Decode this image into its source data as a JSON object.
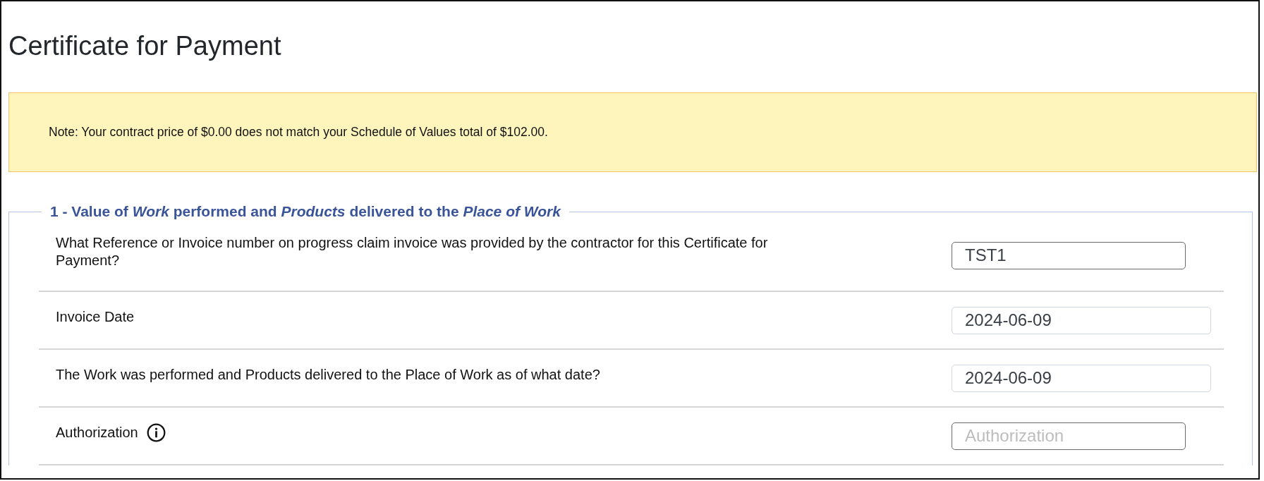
{
  "title": "Certificate for Payment",
  "note": "Note: Your contract price of $0.00 does not match your Schedule of Values total of $102.00.",
  "section": {
    "legend": "1 - Value of *Work* performed and *Products* delivered to the *Place of Work*",
    "rows": [
      {
        "label": "What Reference or Invoice number on progress claim invoice was provided by the contractor for this Certificate for Payment?",
        "has_info": false,
        "field": {
          "kind": "text",
          "value": "TST1"
        }
      },
      {
        "label": "Invoice Date",
        "has_info": false,
        "field": {
          "kind": "date",
          "value": "2024-06-09"
        }
      },
      {
        "label": "The Work was performed and Products delivered to the Place of Work as of what date?",
        "has_info": false,
        "field": {
          "kind": "date",
          "value": "2024-06-09"
        }
      },
      {
        "label": "Authorization",
        "has_info": true,
        "field": {
          "kind": "text",
          "placeholder": "Authorization"
        }
      }
    ]
  }
}
